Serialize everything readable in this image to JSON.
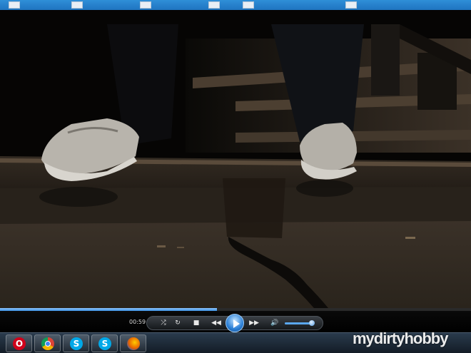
{
  "player": {
    "elapsed_time": "00:59",
    "progress_fraction": 0.46,
    "volume_fraction": 0.9
  },
  "controls": {
    "shuffle_icon": "shuffle-icon",
    "repeat_icon": "repeat-icon",
    "stop_icon": "stop-icon",
    "previous_icon": "rewind-icon",
    "play_icon": "play-icon",
    "next_icon": "fast-forward-icon",
    "volume_icon": "speaker-icon"
  },
  "taskbar": {
    "apps": [
      {
        "name": "Opera",
        "icon": "opera-icon",
        "glyph": "O",
        "color": "#d0021b"
      },
      {
        "name": "Google Chrome",
        "icon": "chrome-icon",
        "glyph": "",
        "color": "#2e9b3e"
      },
      {
        "name": "Skype",
        "icon": "skype-icon",
        "glyph": "S",
        "color": "#00a8e8"
      },
      {
        "name": "Skype",
        "icon": "skype-icon",
        "glyph": "S",
        "color": "#00a8e8"
      },
      {
        "name": "Firefox",
        "icon": "firefox-icon",
        "glyph": "",
        "color": "#e66000"
      }
    ]
  },
  "watermark": {
    "text": "mydirtyhobby"
  }
}
